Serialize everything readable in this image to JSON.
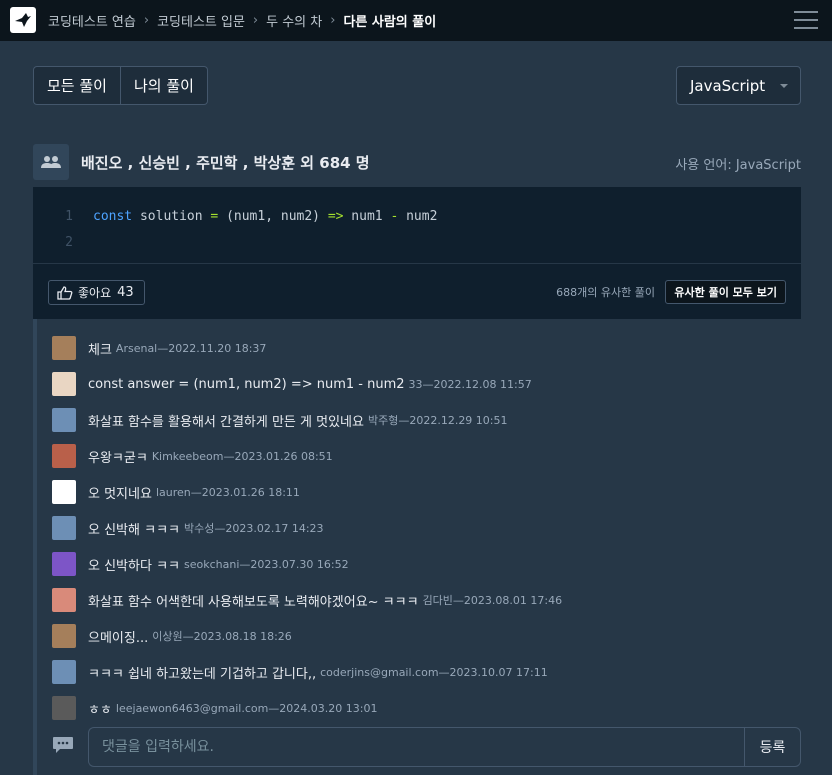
{
  "breadcrumb": [
    "코딩테스트 연습",
    "코딩테스트 입문",
    "두 수의 차",
    "다른 사람의 풀이"
  ],
  "filters": {
    "all": "모든 풀이",
    "mine": "나의 풀이"
  },
  "language_select": {
    "selected": "JavaScript"
  },
  "solution": {
    "authors": "배진오 , 신승빈 , 주민학 , 박상훈 외 684 명",
    "language_used": "사용 언어: JavaScript",
    "code_lines": [
      {
        "num": "1",
        "kw": "const",
        "rest1": " solution ",
        "op1": "=",
        "rest2": " (num1, num2) ",
        "op2": "=>",
        "rest3": " num1 ",
        "op3": "-",
        "rest4": " num2"
      },
      {
        "num": "2"
      }
    ],
    "like_label": "좋아요",
    "like_count": "43",
    "similar_count_text": "688개의 유사한 풀이",
    "similar_button": "유사한 풀이 모두 보기"
  },
  "comments": [
    {
      "text": "체크",
      "meta": "Arsenal—2022.11.20 18:37",
      "avatar_color": "#a57f5b"
    },
    {
      "text": "const answer = (num1, num2) => num1 - num2",
      "meta": "33—2022.12.08 11:57",
      "avatar_color": "#e9d6c3"
    },
    {
      "text": "화살표 함수를 활용해서 간결하게 만든 게 멋있네요",
      "meta": "박주형—2022.12.29 10:51",
      "avatar_color": "#6d8fb5"
    },
    {
      "text": "우왕ㅋ굳ㅋ",
      "meta": "Kimkeebeom—2023.01.26 08:51",
      "avatar_color": "#b9604a"
    },
    {
      "text": "오 멋지네요",
      "meta": "lauren—2023.01.26 18:11",
      "avatar_color": "#ffffff"
    },
    {
      "text": "오 신박해 ㅋㅋㅋ",
      "meta": "박수성—2023.02.17 14:23",
      "avatar_color": "#6d8fb5"
    },
    {
      "text": "오 신박하다 ㅋㅋ",
      "meta": "seokchani—2023.07.30 16:52",
      "avatar_color": "#7d55c7"
    },
    {
      "text": "화살표 함수 어색한데 사용해보도록 노력해야겠어요~ ㅋㅋㅋ",
      "meta": "김다빈—2023.08.01 17:46",
      "avatar_color": "#d98a7a"
    },
    {
      "text": "으메이징...",
      "meta": "이상원—2023.08.18 18:26",
      "avatar_color": "#a57f5b"
    },
    {
      "text": "ㅋㅋㅋ 쉽네 하고왔는데 기겁하고 갑니다,,",
      "meta": "coderjins@gmail.com—2023.10.07 17:11",
      "avatar_color": "#6d8fb5"
    },
    {
      "text": "ㅎㅎ",
      "meta": "leejaewon6463@gmail.com—2024.03.20 13:01",
      "avatar_color": "#5a5a5a"
    }
  ],
  "comment_input": {
    "placeholder": "댓글을 입력하세요.",
    "submit": "등록"
  }
}
